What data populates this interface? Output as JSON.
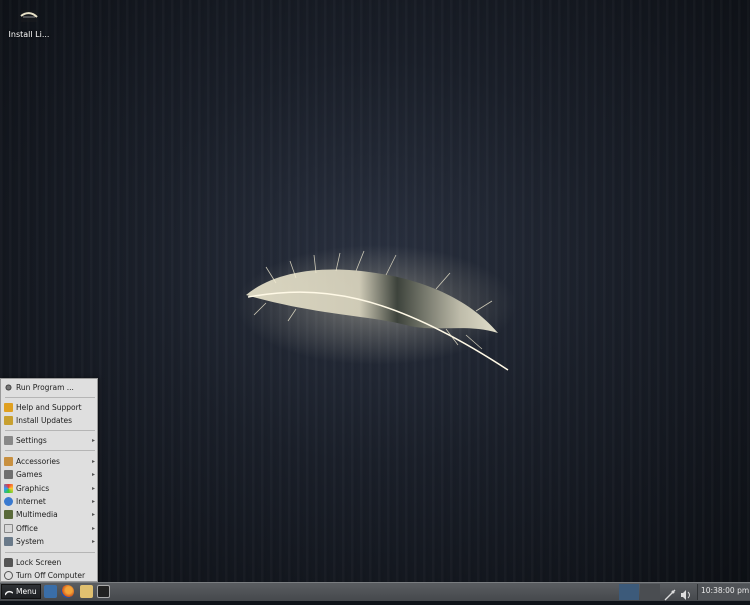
{
  "desktop": {
    "icons": [
      {
        "label": "Install Li...",
        "icon": "installer-feather-icon"
      }
    ]
  },
  "start_menu": {
    "items": [
      {
        "label": "Run Program ...",
        "icon": "gear-icon",
        "submenu": false
      },
      {
        "label": "Help and Support",
        "icon": "help-icon",
        "submenu": false
      },
      {
        "label": "Install Updates",
        "icon": "updates-icon",
        "submenu": false
      },
      {
        "label": "Settings",
        "icon": "settings-icon",
        "submenu": true
      },
      {
        "label": "Accessories",
        "icon": "accessories-icon",
        "submenu": true
      },
      {
        "label": "Games",
        "icon": "games-icon",
        "submenu": true
      },
      {
        "label": "Graphics",
        "icon": "graphics-icon",
        "submenu": true
      },
      {
        "label": "Internet",
        "icon": "internet-icon",
        "submenu": true
      },
      {
        "label": "Multimedia",
        "icon": "multimedia-icon",
        "submenu": true
      },
      {
        "label": "Office",
        "icon": "office-icon",
        "submenu": true
      },
      {
        "label": "System",
        "icon": "system-icon",
        "submenu": true
      },
      {
        "label": "Lock Screen",
        "icon": "lock-icon",
        "submenu": false
      },
      {
        "label": "Turn Off Computer",
        "icon": "power-icon",
        "submenu": false
      }
    ],
    "submenu_arrow": "▸"
  },
  "taskbar": {
    "menu_label": "Menu",
    "launchers": [
      "show-desktop-icon",
      "firefox-icon",
      "file-manager-icon",
      "terminal-icon"
    ],
    "tray_icons": [
      "network-icon",
      "volume-icon"
    ],
    "clock": "10:38:00 pm"
  },
  "colors": {
    "taskbar": "#4f5256",
    "menu_bg": "#dfdfdf",
    "active_workspace": "#3c5a7a"
  }
}
